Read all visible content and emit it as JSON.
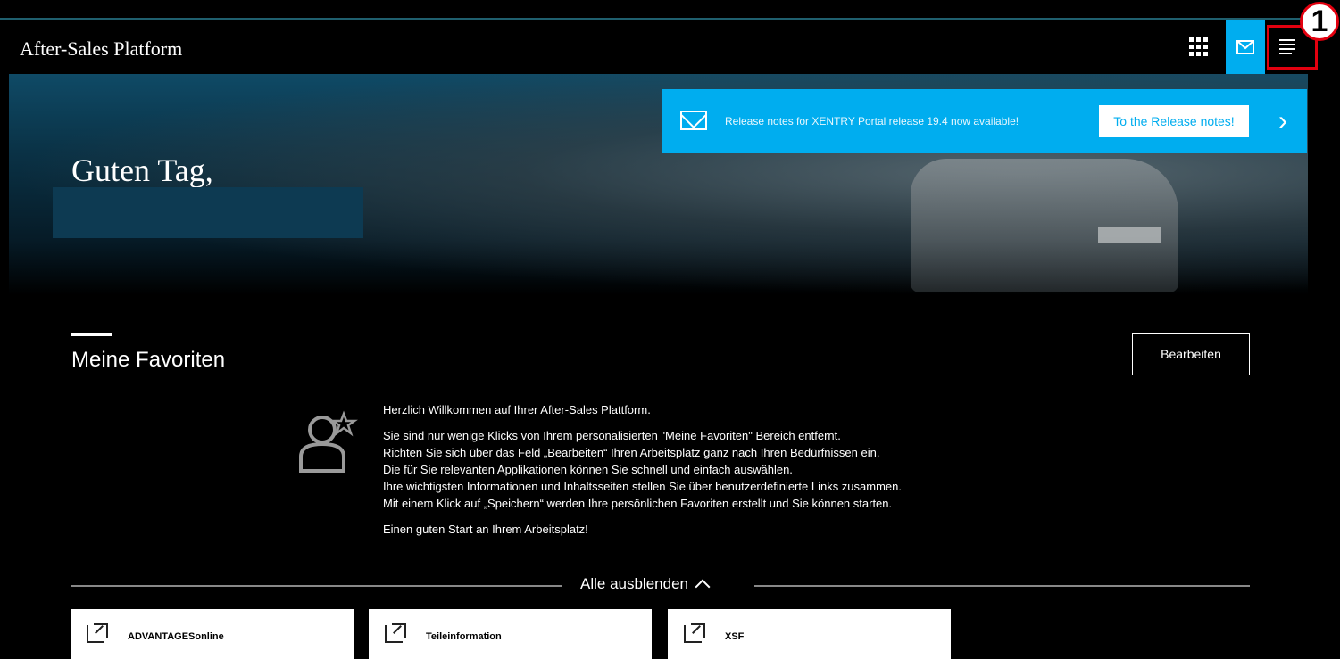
{
  "header": {
    "brand": "After-Sales Platform",
    "icons": [
      "apps-grid-icon",
      "mail-icon",
      "menu-icon"
    ]
  },
  "annotation": {
    "step": "1"
  },
  "hero": {
    "greeting": "Guten Tag,"
  },
  "notification": {
    "text": "Release notes for XENTRY Portal release 19.4 now available!",
    "button_label": "To the Release notes!",
    "next_glyph": "›"
  },
  "favorites": {
    "title": "Meine Favoriten",
    "edit_label": "Bearbeiten",
    "welcome_lines": [
      "Herzlich Willkommen auf Ihrer After-Sales Plattform.",
      "Sie sind nur wenige Klicks von Ihrem personalisierten \"Meine Favoriten\" Bereich entfernt.",
      "Richten Sie sich über das Feld „Bearbeiten“ Ihren Arbeitsplatz ganz nach Ihren Bedürfnissen ein.",
      "Die für Sie relevanten Applikationen können Sie schnell und einfach auswählen.",
      "Ihre wichtigsten Informationen und Inhaltsseiten stellen Sie über benutzerdefinierte Links zusammen.",
      "Mit einem Klick auf „Speichern“ werden Ihre persönlichen Favoriten erstellt und Sie können starten.",
      "Einen guten Start an Ihrem Arbeitsplatz!"
    ],
    "collapse_label": "Alle ausblenden",
    "tiles": [
      {
        "label": "ADVANTAGESonline"
      },
      {
        "label": "Teileinformation"
      },
      {
        "label": "XSF"
      }
    ]
  },
  "colors": {
    "accent": "#00adef",
    "highlight": "#e3000f",
    "background": "#000000"
  }
}
